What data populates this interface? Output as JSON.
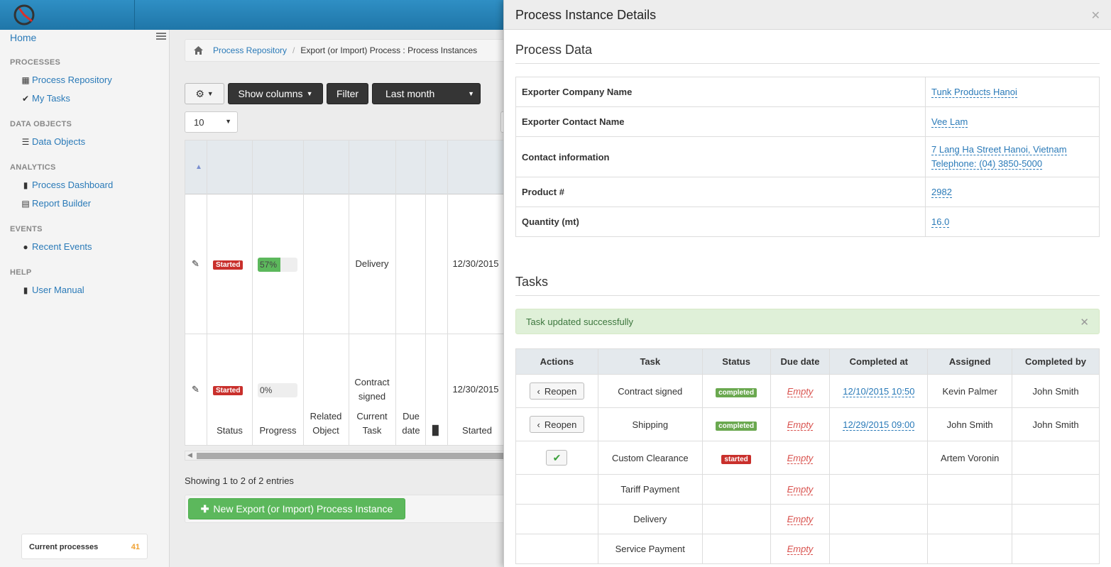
{
  "sidebar": {
    "home": "Home",
    "sections": [
      {
        "title": "PROCESSES",
        "items": [
          {
            "label": "Process Repository",
            "icon": "grid-icon"
          },
          {
            "label": "My Tasks",
            "icon": "check-circle-icon"
          }
        ]
      },
      {
        "title": "DATA OBJECTS",
        "items": [
          {
            "label": "Data Objects",
            "icon": "list-icon"
          }
        ]
      },
      {
        "title": "ANALYTICS",
        "items": [
          {
            "label": "Process Dashboard",
            "icon": "bar-chart-icon"
          },
          {
            "label": "Report Builder",
            "icon": "table-icon"
          }
        ]
      },
      {
        "title": "EVENTS",
        "items": [
          {
            "label": "Recent Events",
            "icon": "globe-icon"
          }
        ]
      },
      {
        "title": "HELP",
        "items": [
          {
            "label": "User Manual",
            "icon": "book-icon"
          }
        ]
      }
    ],
    "current_processes": {
      "label": "Current processes",
      "count": "41"
    }
  },
  "breadcrumb": {
    "link": "Process Repository",
    "current": "Export (or Import) Process : Process Instances"
  },
  "toolbar": {
    "show_columns": "Show columns",
    "filter": "Filter",
    "period": "Last month",
    "page_size": "10"
  },
  "grid": {
    "headers": [
      "Status",
      "Progress",
      "Related Object",
      "Current Task",
      "Due date",
      "Started"
    ],
    "rows": [
      {
        "status": "Started",
        "progress_text": "57%",
        "progress": 0.57,
        "current_task": "Delivery",
        "started": "12/30/2015"
      },
      {
        "status": "Started",
        "progress_text": "0%",
        "progress": 0,
        "current_task": "Contract signed",
        "started": "12/30/2015"
      }
    ]
  },
  "showing": "Showing 1 to 2 of 2 entries",
  "new_button": "New Export (or Import) Process Instance",
  "panel": {
    "title": "Process Instance Details",
    "process_data_title": "Process Data",
    "fields": [
      {
        "key": "Exporter Company Name",
        "value": "Tunk Products Hanoi"
      },
      {
        "key": "Exporter Contact Name",
        "value": "Vee Lam"
      },
      {
        "key": "Contact information",
        "value": "7 Lang Ha Street Hanoi, Vietnam",
        "value2": "Telephone: (04) 3850-5000"
      },
      {
        "key": "Product #",
        "value": "2982"
      },
      {
        "key": "Quantity (mt)",
        "value": "16.0"
      }
    ],
    "tasks_title": "Tasks",
    "alert": "Task updated successfully",
    "task_headers": [
      "Actions",
      "Task",
      "Status",
      "Due date",
      "Completed at",
      "Assigned",
      "Completed by"
    ],
    "tasks": [
      {
        "action": "Reopen",
        "task": "Contract signed",
        "status": "completed",
        "due": "Empty",
        "completed_at": "12/10/2015 10:50",
        "assigned": "Kevin Palmer",
        "completed_by": "John Smith"
      },
      {
        "action": "Reopen",
        "task": "Shipping",
        "status": "completed",
        "due": "Empty",
        "completed_at": "12/29/2015 09:00",
        "assigned": "John Smith",
        "completed_by": "John Smith"
      },
      {
        "action": "check",
        "task": "Custom Clearance",
        "status": "started",
        "due": "Empty",
        "completed_at": "",
        "assigned": "Artem Voronin",
        "completed_by": ""
      },
      {
        "action": "",
        "task": "Tariff Payment",
        "status": "",
        "due": "Empty",
        "completed_at": "",
        "assigned": "",
        "completed_by": ""
      },
      {
        "action": "",
        "task": "Delivery",
        "status": "",
        "due": "Empty",
        "completed_at": "",
        "assigned": "",
        "completed_by": ""
      },
      {
        "action": "",
        "task": "Service Payment",
        "status": "",
        "due": "Empty",
        "completed_at": "",
        "assigned": "",
        "completed_by": ""
      }
    ]
  },
  "colors": {
    "accent": "#2a7ab8",
    "topbar": "#2a86ba",
    "success": "#5cb85c",
    "danger": "#c9302c"
  }
}
